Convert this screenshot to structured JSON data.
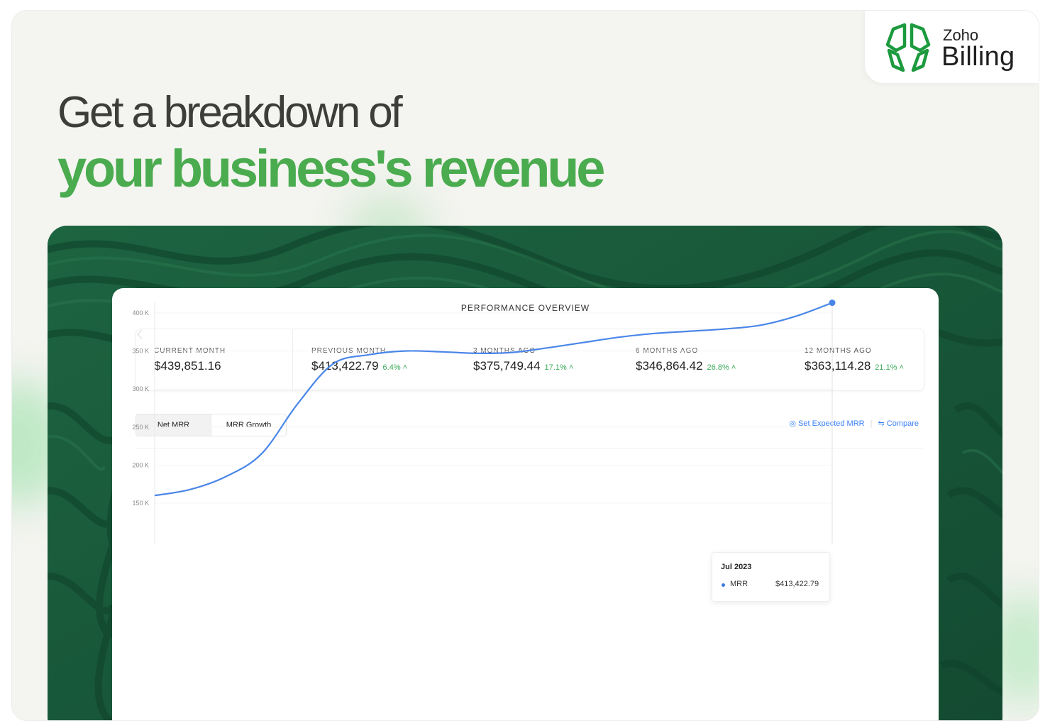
{
  "brand": {
    "logo_top": "Zoho",
    "logo_bottom": "Billing",
    "logo_color": "#1c9a3e"
  },
  "headline": {
    "line1": "Get a breakdown of",
    "line2": "your business's revenue",
    "accent_color": "#4aab4f"
  },
  "panel": {
    "title": "PERFORMANCE OVERVIEW",
    "stats": [
      {
        "label": "CURRENT MONTH",
        "value": "$439,851.16",
        "change": ""
      },
      {
        "label": "PREVIOUS MONTH",
        "value": "$413,422.79",
        "change": "6.4%"
      },
      {
        "label": "3 MONTHS AGO",
        "value": "$375,749.44",
        "change": "17.1%"
      },
      {
        "label": "6 MONTHS AGO",
        "value": "$346,864.42",
        "change": "26.8%"
      },
      {
        "label": "12 MONTHS AGO",
        "value": "$363,114.28",
        "change": "21.1%"
      }
    ],
    "tabs": [
      {
        "label": "Net MRR",
        "selected": true
      },
      {
        "label": "MRR Growth",
        "selected": false
      }
    ],
    "actions": {
      "set_expected": "Set Expected MRR",
      "compare": "Compare"
    },
    "tooltip": {
      "title": "Jul 2023",
      "series": "MRR",
      "value": "$413,422.79"
    }
  },
  "chart_data": {
    "type": "line",
    "title": "",
    "xlabel": "",
    "ylabel": "",
    "y_ticks": [
      "400 K",
      "350 K",
      "300 K",
      "250 K",
      "200 K",
      "150 K"
    ],
    "ylim": [
      150000,
      410000
    ],
    "series": [
      {
        "name": "MRR",
        "color": "#4a86e8",
        "values": [
          160000,
          168000,
          185000,
          215000,
          280000,
          333000,
          345000,
          350000,
          349000,
          347000,
          348000,
          354000,
          361000,
          368000,
          373000,
          376000,
          379000,
          384000,
          396000,
          413422.79
        ]
      }
    ],
    "highlight_index": 19,
    "grid": "horizontal",
    "legend": "none"
  }
}
